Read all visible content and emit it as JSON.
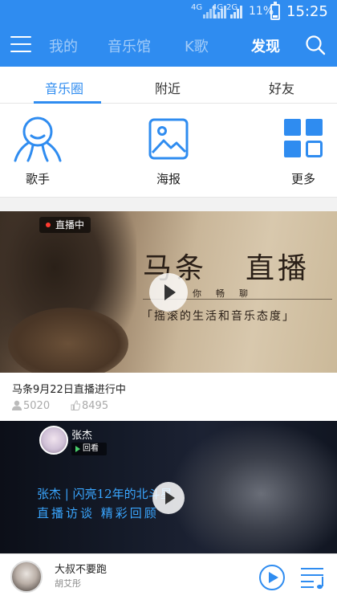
{
  "status_bar": {
    "signal_1": "4G",
    "signal_2": "4G",
    "signal_3": "2G",
    "battery": "11%",
    "time": "15:25"
  },
  "header": {
    "tabs": [
      {
        "label": "我的",
        "active": false
      },
      {
        "label": "音乐馆",
        "active": false
      },
      {
        "label": "K歌",
        "active": false
      },
      {
        "label": "发现",
        "active": true
      }
    ],
    "menu_icon": "hamburger-menu-icon",
    "search_icon": "search-icon"
  },
  "subtabs": [
    {
      "label": "音乐圈",
      "active": true
    },
    {
      "label": "附近",
      "active": false
    },
    {
      "label": "好友",
      "active": false
    }
  ],
  "categories": [
    {
      "label": "歌手",
      "icon": "singer-icon"
    },
    {
      "label": "海报",
      "icon": "poster-image-icon"
    },
    {
      "label": "更多",
      "icon": "grid-more-icon"
    }
  ],
  "live_card_1": {
    "badge": "直播中",
    "poster_title_1": "马条",
    "poster_title_2": "直播",
    "poster_sub": "你畅聊",
    "poster_tag": "「摇滚的生活和音乐态度」",
    "title": "马条9月22日直播进行中",
    "views": "5020",
    "likes": "8495"
  },
  "live_card_2": {
    "user_name": "张杰",
    "replay_label": "回看",
    "headline": "张杰 | 闪亮12年的北斗星",
    "subline": "直播访谈 精彩回顾"
  },
  "mini_player": {
    "song": "大叔不要跑",
    "artist": "胡艾彤"
  },
  "colors": {
    "accent": "#2f8cf0",
    "live_dot": "#ff3b30"
  }
}
